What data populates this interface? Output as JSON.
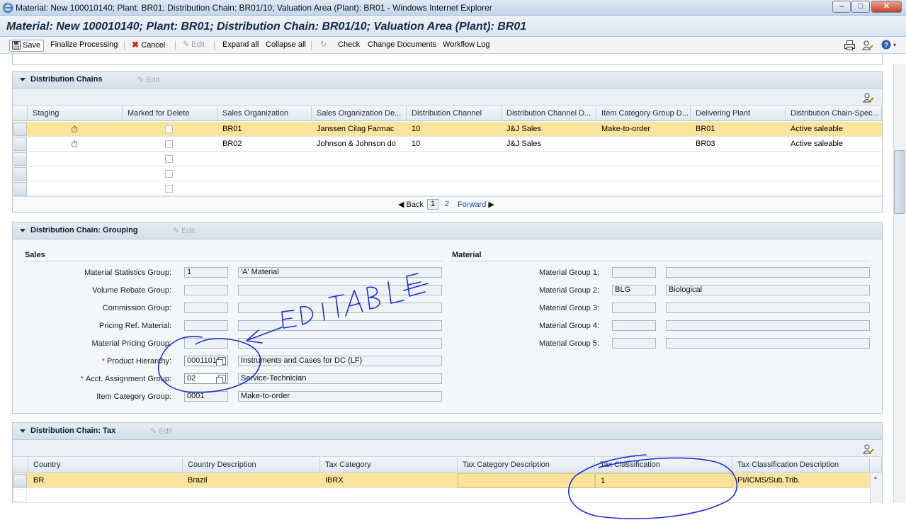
{
  "window": {
    "title": "Material: New 100010140; Plant: BR01; Distribution Chain: BR01/10; Valuation Area (Plant): BR01 - Windows Internet Explorer"
  },
  "page": {
    "title": "Material: New 100010140; Plant: BR01; Distribution Chain: BR01/10; Valuation Area (Plant): BR01"
  },
  "toolbar": {
    "save": "Save",
    "finalize": "Finalize Processing",
    "cancel": "Cancel",
    "edit": "Edit",
    "expand_all": "Expand all",
    "collapse_all": "Collapse all",
    "check": "Check",
    "change_documents": "Change Documents",
    "workflow_log": "Workflow Log"
  },
  "dist_chains": {
    "title": "Distribution Chains",
    "edit": "Edit",
    "columns": [
      "Staging",
      "Marked for Delete",
      "Sales Organization",
      "Sales Organization De...",
      "Distribution Channel",
      "Distribution Channel D...",
      "Item Category Group D...",
      "Delivering Plant",
      "Distribution Chain-Spec..."
    ],
    "rows": [
      {
        "sales_org": "BR01",
        "sales_org_desc": "Janssen Cilag Farmac",
        "channel": "10",
        "channel_desc": "J&J Sales",
        "item_cat": "Make-to-order",
        "plant": "BR01",
        "spec": "Active saleable"
      },
      {
        "sales_org": "BR02",
        "sales_org_desc": "Johnson & Johnson do",
        "channel": "10",
        "channel_desc": "J&J Sales",
        "item_cat": "",
        "plant": "BR03",
        "spec": "Active saleable"
      }
    ],
    "pager": {
      "back": "Back",
      "page1": "1",
      "page2": "2",
      "forward": "Forward"
    }
  },
  "grouping": {
    "title": "Distribution Chain: Grouping",
    "edit": "Edit",
    "sales_header": "Sales",
    "material_header": "Material",
    "sales_fields": [
      {
        "label": "Material Statistics Group:",
        "code": "1",
        "desc": "'A' Material"
      },
      {
        "label": "Volume Rebate Group:",
        "code": "",
        "desc": ""
      },
      {
        "label": "Commission Group:",
        "code": "",
        "desc": ""
      },
      {
        "label": "Pricing Ref. Material:",
        "code": "",
        "desc": ""
      },
      {
        "label": "Material Pricing Group:",
        "code": "",
        "desc": ""
      },
      {
        "label": "Product Hierarchy:",
        "code": "00011010",
        "desc": "Instruments and Cases for DC (LF)"
      },
      {
        "label": "Acct. Assignment Group:",
        "code": "02",
        "desc": "Service-Technician"
      },
      {
        "label": "Item Category Group:",
        "code": "0001",
        "desc": "Make-to-order"
      }
    ],
    "required_mark": "*",
    "material_fields": [
      {
        "label": "Material Group 1:",
        "code": "",
        "desc": ""
      },
      {
        "label": "Material Group 2:",
        "code": "BLG",
        "desc": "Biological"
      },
      {
        "label": "Material Group 3:",
        "code": "",
        "desc": ""
      },
      {
        "label": "Material Group 4:",
        "code": "",
        "desc": ""
      },
      {
        "label": "Material Group 5:",
        "code": "",
        "desc": ""
      }
    ]
  },
  "tax": {
    "title": "Distribution Chain: Tax",
    "edit": "Edit",
    "columns": [
      "Country",
      "Country Description",
      "Tax Category",
      "Tax Category Description",
      "Tax Classification",
      "Tax Classification Description"
    ],
    "rows": [
      {
        "country": "BR",
        "country_desc": "Brazil",
        "category": "IBRX",
        "category_desc": "",
        "classification": "1",
        "classification_desc": "PI/ICMS/Sub.Trib."
      }
    ]
  },
  "annotation": {
    "text": "EDITABLE",
    "color": "#1f2fd0"
  }
}
